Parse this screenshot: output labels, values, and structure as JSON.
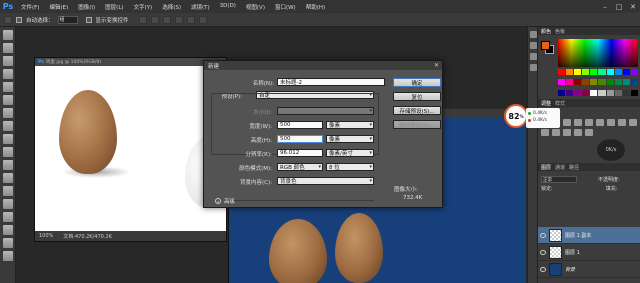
{
  "app": {
    "logo": "Ps"
  },
  "menu": [
    "文件(F)",
    "编辑(E)",
    "图像(I)",
    "图层(L)",
    "文字(Y)",
    "选择(S)",
    "滤镜(T)",
    "3D(D)",
    "视图(V)",
    "窗口(W)",
    "帮助(H)"
  ],
  "options_bar": {
    "auto_select_label": "自动选择：",
    "auto_select_value": "组",
    "show_transform_label": "显示变换控件"
  },
  "document": {
    "tab_title": "鸡蛋.jpg @ 100%(RGB/8)",
    "zoom": "100%",
    "doc_size": "文档:470.2K/470.2K"
  },
  "dialog": {
    "title": "新建",
    "fields": {
      "name_label": "名称(N):",
      "name_value": "未标题-2",
      "preset_label": "预设(P):",
      "preset_value": "自定",
      "size_label": "大小(I):",
      "width_label": "宽度(W):",
      "width_value": "500",
      "width_unit": "像素",
      "height_label": "高度(H):",
      "height_value": "500",
      "height_unit": "像素",
      "resolution_label": "分辨率(R):",
      "resolution_value": "96.012",
      "resolution_unit": "像素/英寸",
      "color_mode_label": "颜色模式(M):",
      "color_mode_value": "RGB 颜色",
      "bit_depth": "8 位",
      "bg_label": "背景内容(C):",
      "bg_value": "背景色"
    },
    "advanced_label": "高级",
    "image_size_label": "图像大小:",
    "image_size_value": "732.4K",
    "buttons": {
      "ok": "确定",
      "reset": "复位",
      "save_preset": "存储预设(S)...",
      "delete_preset": "删除预设(D)..."
    }
  },
  "panels": {
    "color_tabs": [
      "颜色",
      "色板"
    ],
    "adjust_tabs": [
      "调整",
      "样式"
    ],
    "layer_tabs": [
      "图层",
      "通道",
      "路径"
    ],
    "blend_mode": "正常",
    "opacity_label": "不透明度:",
    "lock_label": "锁定:",
    "fill_label": "填充:",
    "layers": [
      {
        "name": "图层 1 副本",
        "thumb": "checker",
        "selected": true
      },
      {
        "name": "图层 1",
        "thumb": "checker",
        "selected": false
      },
      {
        "name": "背景",
        "thumb": "blue",
        "selected": false
      }
    ]
  },
  "speed_widget": {
    "percent": "82",
    "percent_sign": "%",
    "up": "0.4K/s",
    "down": "0.4K/s",
    "circle_value": "0K/s"
  },
  "colors": {
    "accent": "#3aa0ff",
    "fg": "#e8621a",
    "canvas_blue": "#173f79",
    "selected_layer": "#4e6f96"
  }
}
